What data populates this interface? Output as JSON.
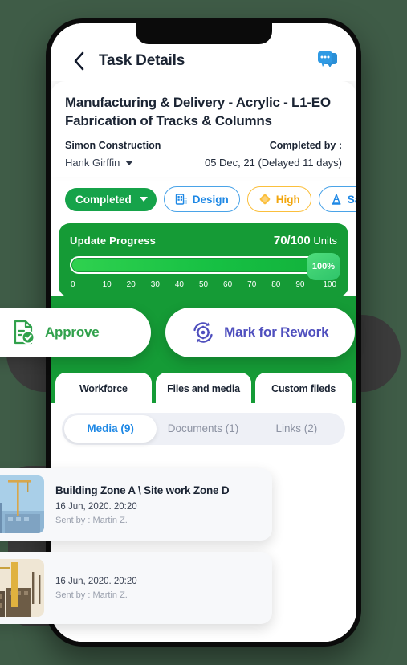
{
  "header": {
    "title": "Task Details",
    "back_icon": "chevron-left-icon",
    "chat_icon": "chat-bubble-icon"
  },
  "task": {
    "title": "Manufacturing & Delivery - Acrylic - L1-EO Fabrication of Tracks & Columns",
    "company": "Simon Construction",
    "assignee": "Hank Girffin",
    "completed_by_label": "Completed by :",
    "completed_by_value": "05 Dec, 21 (Delayed 11 days)"
  },
  "chips": {
    "status": "Completed",
    "tags": [
      {
        "label": "Design",
        "icon": "blueprint-icon",
        "style": "blue"
      },
      {
        "label": "High",
        "icon": "diamond-icon",
        "style": "amber"
      },
      {
        "label": "Safety",
        "icon": "traffic-cone-icon",
        "style": "blue"
      }
    ]
  },
  "progress": {
    "label": "Update Progress",
    "units_value": "70/100",
    "units_suffix": "Units",
    "percent_badge": "100%",
    "fill_percent": 100,
    "ticks": [
      "0",
      "10",
      "20",
      "30",
      "40",
      "50",
      "60",
      "70",
      "80",
      "90",
      "100"
    ]
  },
  "actions": {
    "approve": {
      "label": "Approve",
      "icon": "document-check-icon",
      "color": "#31a14c"
    },
    "rework": {
      "label": "Mark for Rework",
      "icon": "gear-refresh-icon",
      "color": "#4f4fbe"
    }
  },
  "tabs": [
    {
      "label": "Workforce"
    },
    {
      "label": "Files and media"
    },
    {
      "label": "Custom fileds"
    }
  ],
  "subtabs": [
    {
      "label": "Media (9)",
      "active": true
    },
    {
      "label": "Documents (1)",
      "active": false
    },
    {
      "label": "Links (2)",
      "active": false
    }
  ],
  "media_items": [
    {
      "title": "Building Zone A \\ Site work Zone D",
      "date": "16 Jun, 2020. 20:20",
      "sender": "Sent by : Martin Z.",
      "thumb": "construction-site-blue"
    },
    {
      "title": "",
      "date": "16 Jun, 2020. 20:20",
      "sender": "Sent by : Martin Z.",
      "thumb": "construction-site-sepia"
    }
  ],
  "colors": {
    "background": "#3f5c47",
    "accent_green": "#159b36",
    "status_green": "#16a34a",
    "blue": "#1e88e5",
    "amber": "#f2a60d",
    "purple": "#4f4fbe",
    "backdrop_dark": "#3c3c3c"
  }
}
